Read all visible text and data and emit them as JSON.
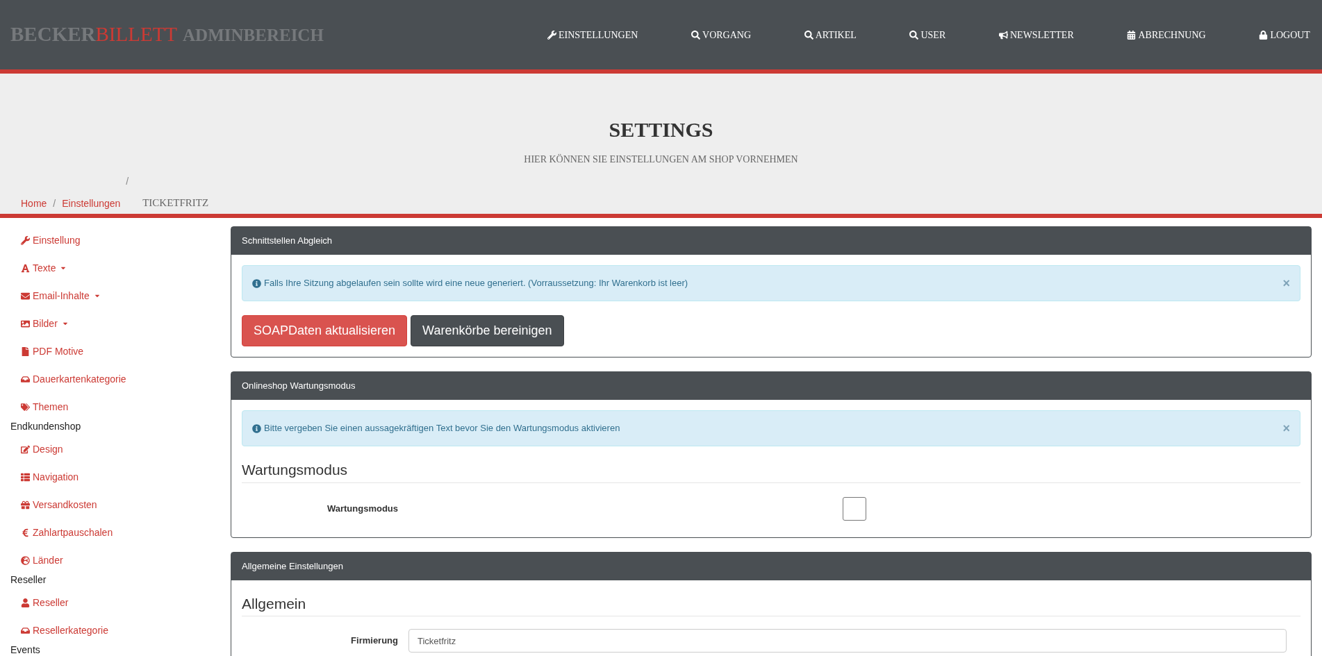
{
  "header": {
    "logo_parts": [
      {
        "text": "BECKER",
        "color": "#76797c"
      },
      {
        "text": "BILLETT",
        "color": "#cc3a34"
      },
      {
        "text": "ADMINBEREICH",
        "color": "#76797c"
      }
    ],
    "nav": [
      {
        "label": "EINSTELLUNGEN"
      },
      {
        "label": "VORGANG"
      },
      {
        "label": "ARTIKEL"
      },
      {
        "label": "USER"
      },
      {
        "label": "NEWSLETTER"
      },
      {
        "label": "ABRECHNUNG"
      },
      {
        "label": "LOGOUT"
      }
    ]
  },
  "page_header": {
    "title": "SETTINGS",
    "subtitle": "HIER KÖNNEN SIE EINSTELLUNGEN AM SHOP VORNEHMEN"
  },
  "breadcrumb": {
    "separator": "/",
    "items": [
      {
        "text": "Home",
        "current": false
      },
      {
        "text": "Einstellungen",
        "current": false
      },
      {
        "text": "TICKETFRITZ",
        "current": true
      }
    ]
  },
  "sidebar": [
    {
      "kind": "link",
      "label": "Einstellung",
      "dropdown": false
    },
    {
      "kind": "link",
      "label": "Texte",
      "dropdown": true
    },
    {
      "kind": "link",
      "label": "Email-Inhalte",
      "dropdown": true
    },
    {
      "kind": "link",
      "label": "Bilder",
      "dropdown": true
    },
    {
      "kind": "link",
      "label": "PDF Motive",
      "dropdown": false
    },
    {
      "kind": "link",
      "label": "Dauerkartenkategorie",
      "dropdown": false
    },
    {
      "kind": "link",
      "label": "Themen",
      "dropdown": false
    },
    {
      "kind": "heading",
      "label": "Endkundenshop"
    },
    {
      "kind": "link",
      "label": "Design",
      "dropdown": false
    },
    {
      "kind": "link",
      "label": "Navigation",
      "dropdown": false
    },
    {
      "kind": "link",
      "label": "Versandkosten",
      "dropdown": false
    },
    {
      "kind": "link",
      "label": "Zahlartpauschalen",
      "dropdown": false
    },
    {
      "kind": "link",
      "label": "Länder",
      "dropdown": false
    },
    {
      "kind": "heading",
      "label": "Reseller"
    },
    {
      "kind": "link",
      "label": "Reseller",
      "dropdown": false
    },
    {
      "kind": "link",
      "label": "Resellerkategorie",
      "dropdown": false
    },
    {
      "kind": "heading",
      "label": "Events"
    }
  ],
  "panels": [
    {
      "title": "Schnittstellen Abgleich",
      "body": [
        {
          "kind": "alert",
          "text": "Falls Ihre Sitzung abgelaufen sein sollte wird eine neue generiert. (Vorraussetzung: Ihr Warenkorb ist leer)",
          "close": "×"
        },
        {
          "kind": "buttons",
          "buttons": [
            {
              "label": "SOAPDaten aktualisieren"
            },
            {
              "label": "Warenkörbe bereinigen"
            }
          ]
        }
      ]
    },
    {
      "title": "Onlineshop Wartungsmodus",
      "body": [
        {
          "kind": "alert",
          "text": "Bitte vergeben Sie einen aussagekräftigen Text bevor Sie den Wartungsmodus aktivieren",
          "close": "×"
        },
        {
          "kind": "section",
          "text": "Wartungsmodus"
        },
        {
          "kind": "checkbox",
          "label": "Wartungsmodus",
          "checked": false
        }
      ]
    },
    {
      "title": "Allgemeine Einstellungen",
      "body": [
        {
          "kind": "section",
          "text": "Allgemein"
        },
        {
          "kind": "textfield",
          "label": "Firmierung",
          "value": "Ticketfritz"
        }
      ]
    }
  ]
}
